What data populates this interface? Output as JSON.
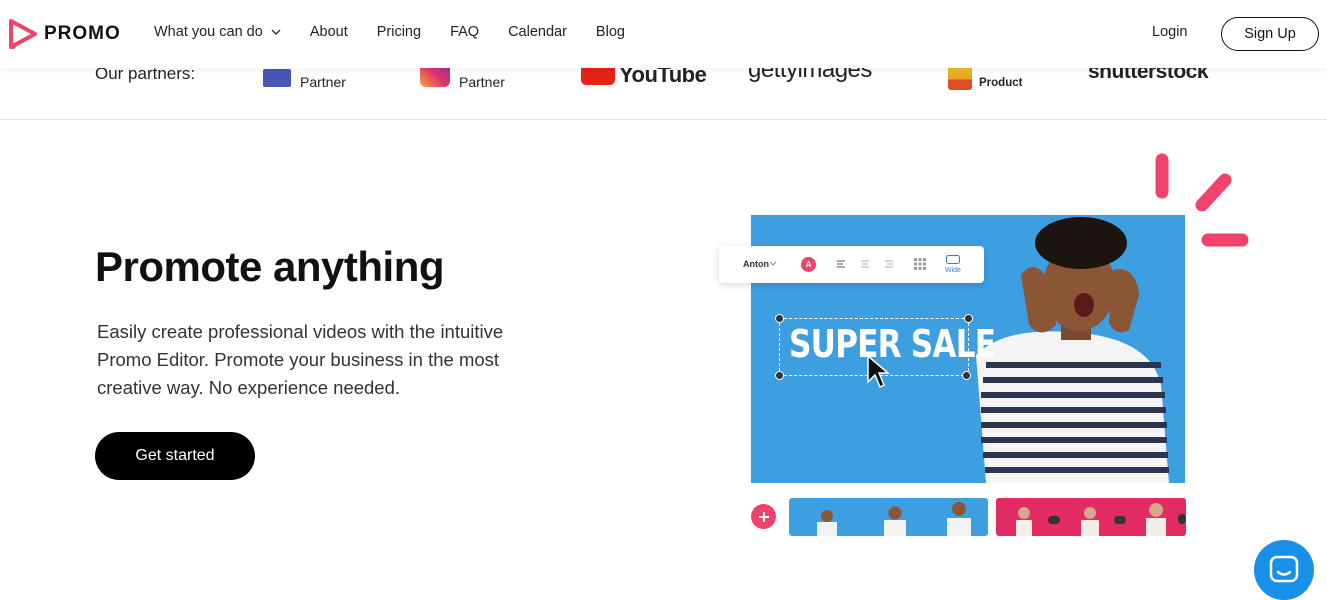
{
  "brand": {
    "name": "PROMO",
    "accent": "#f0436b"
  },
  "nav": {
    "items": [
      {
        "label": "What you can do",
        "has_dropdown": true
      },
      {
        "label": "About"
      },
      {
        "label": "Pricing"
      },
      {
        "label": "FAQ"
      },
      {
        "label": "Calendar"
      },
      {
        "label": "Blog"
      }
    ],
    "login": "Login",
    "signup": "Sign Up"
  },
  "partners": {
    "label": "Our partners:",
    "items": [
      {
        "name": "facebook-partner",
        "caption": "Partner"
      },
      {
        "name": "instagram-partner",
        "caption": "Partner"
      },
      {
        "name": "youtube",
        "caption": "YouTube"
      },
      {
        "name": "gettyimages",
        "caption": "gettyimages"
      },
      {
        "name": "product-hunt",
        "caption": "Product"
      },
      {
        "name": "shutterstock",
        "caption": "shutterstock"
      }
    ]
  },
  "hero": {
    "title": "Promote anything",
    "description": "Easily create professional videos with the intuitive Promo Editor. Promote your business in the most creative way. No experience needed.",
    "cta": "Get started"
  },
  "editor_preview": {
    "font": "Anton",
    "color_swatch_letter": "A",
    "wide_label": "Wide",
    "overlay_text": "SUPER SALE",
    "photo_bg": "#3d9ee0",
    "clip2_bg": "#e32b63"
  }
}
